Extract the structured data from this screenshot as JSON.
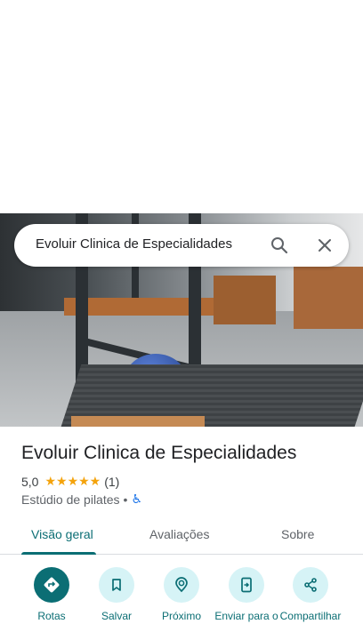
{
  "search": {
    "query": "Evoluir Clinica de Especialidades"
  },
  "place": {
    "name": "Evoluir Clinica de Especialidades",
    "rating": "5,0",
    "stars": "★★★★★",
    "review_count": "(1)",
    "category": "Estúdio de pilates",
    "separator": "•",
    "accessibility_icon": "♿"
  },
  "tabs": [
    {
      "label": "Visão geral",
      "active": true
    },
    {
      "label": "Avaliações",
      "active": false
    },
    {
      "label": "Sobre",
      "active": false
    }
  ],
  "actions": [
    {
      "label": "Rotas",
      "icon": "directions-icon"
    },
    {
      "label": "Salvar",
      "icon": "bookmark-icon"
    },
    {
      "label": "Próximo",
      "icon": "nearby-icon"
    },
    {
      "label": "Enviar para o",
      "icon": "send-to-phone-icon"
    },
    {
      "label": "Compartilhar",
      "icon": "share-icon"
    }
  ],
  "colors": {
    "accent": "#0b6e74",
    "accent_light": "#d6f3f6",
    "star": "#f4a30c"
  }
}
